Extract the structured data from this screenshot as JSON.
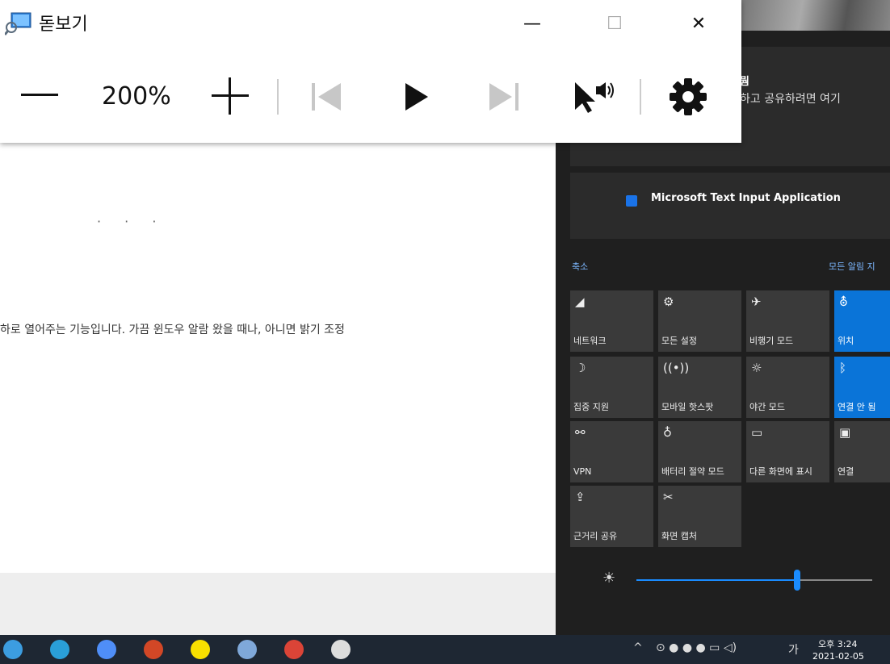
{
  "document": {
    "body_text": "하로 열어주는 기능입니다. 가끔 윈도우 알람 왔을 때나, 아니면 밝기 조정",
    "ellipsis": "· · ·"
  },
  "magnifier": {
    "title": "돋보기",
    "zoom_level": "200%",
    "minimize_glyph": "—",
    "maximize_glyph": "☐",
    "close_glyph": "✕"
  },
  "action_center": {
    "notification_title": "뭠",
    "notification_text": "하고 공유하려면 여기",
    "app_notification": "Microsoft Text Input Application",
    "collapse_label": "축소",
    "all_notifications_label": "모든 알림 지",
    "tiles": [
      {
        "label": "네트워크",
        "icon": "network-icon",
        "glyph": "◢",
        "active": false
      },
      {
        "label": "모든 설정",
        "icon": "gear-icon",
        "glyph": "⚙",
        "active": false
      },
      {
        "label": "비행기 모드",
        "icon": "airplane-icon",
        "glyph": "✈",
        "active": false
      },
      {
        "label": "위치",
        "icon": "location-icon",
        "glyph": "⛢",
        "active": true
      },
      {
        "label": "집중 지원",
        "icon": "moon-icon",
        "glyph": "☽",
        "active": false
      },
      {
        "label": "모바일 핫스팟",
        "icon": "hotspot-icon",
        "glyph": "((•))",
        "active": false
      },
      {
        "label": "야간 모드",
        "icon": "night-light-icon",
        "glyph": "☼",
        "active": false
      },
      {
        "label": "연결 안 됨",
        "icon": "bluetooth-icon",
        "glyph": "ᛒ",
        "active": true
      },
      {
        "label": "VPN",
        "icon": "vpn-icon",
        "glyph": "⚯",
        "active": false
      },
      {
        "label": "배터리 절약 모드",
        "icon": "battery-saver-icon",
        "glyph": "♁",
        "active": false
      },
      {
        "label": "다른 화면에 표시",
        "icon": "project-icon",
        "glyph": "▭",
        "active": false
      },
      {
        "label": "연결",
        "icon": "connect-icon",
        "glyph": "▣",
        "active": false
      },
      {
        "label": "근거리 공유",
        "icon": "nearby-share-icon",
        "glyph": "⇪",
        "active": false
      },
      {
        "label": "화면 캡처",
        "icon": "screen-snip-icon",
        "glyph": "✂",
        "active": false
      }
    ],
    "brightness": 0.68
  },
  "taskbar": {
    "apps": [
      {
        "name": "chrome-app-icon",
        "color": "#3c9de0"
      },
      {
        "name": "edge-app-icon",
        "color": "#2a9fd8"
      },
      {
        "name": "notes-app-icon",
        "color": "#4f8ef7"
      },
      {
        "name": "powerpoint-app-icon",
        "color": "#d24726"
      },
      {
        "name": "kakaotalk-app-icon",
        "color": "#f9e000"
      },
      {
        "name": "pen-app-icon",
        "color": "#7fa8d9"
      },
      {
        "name": "chrome-app-icon-2",
        "color": "#db4437"
      },
      {
        "name": "settings-app-icon",
        "color": "#dddddd"
      }
    ],
    "ime_label": "가",
    "time": "오후 3:24",
    "date": "2021-02-05"
  },
  "colors": {
    "accent": "#0a74d8",
    "taskbar": "#1e2733",
    "action_center_bg": "#1f1f1f"
  }
}
